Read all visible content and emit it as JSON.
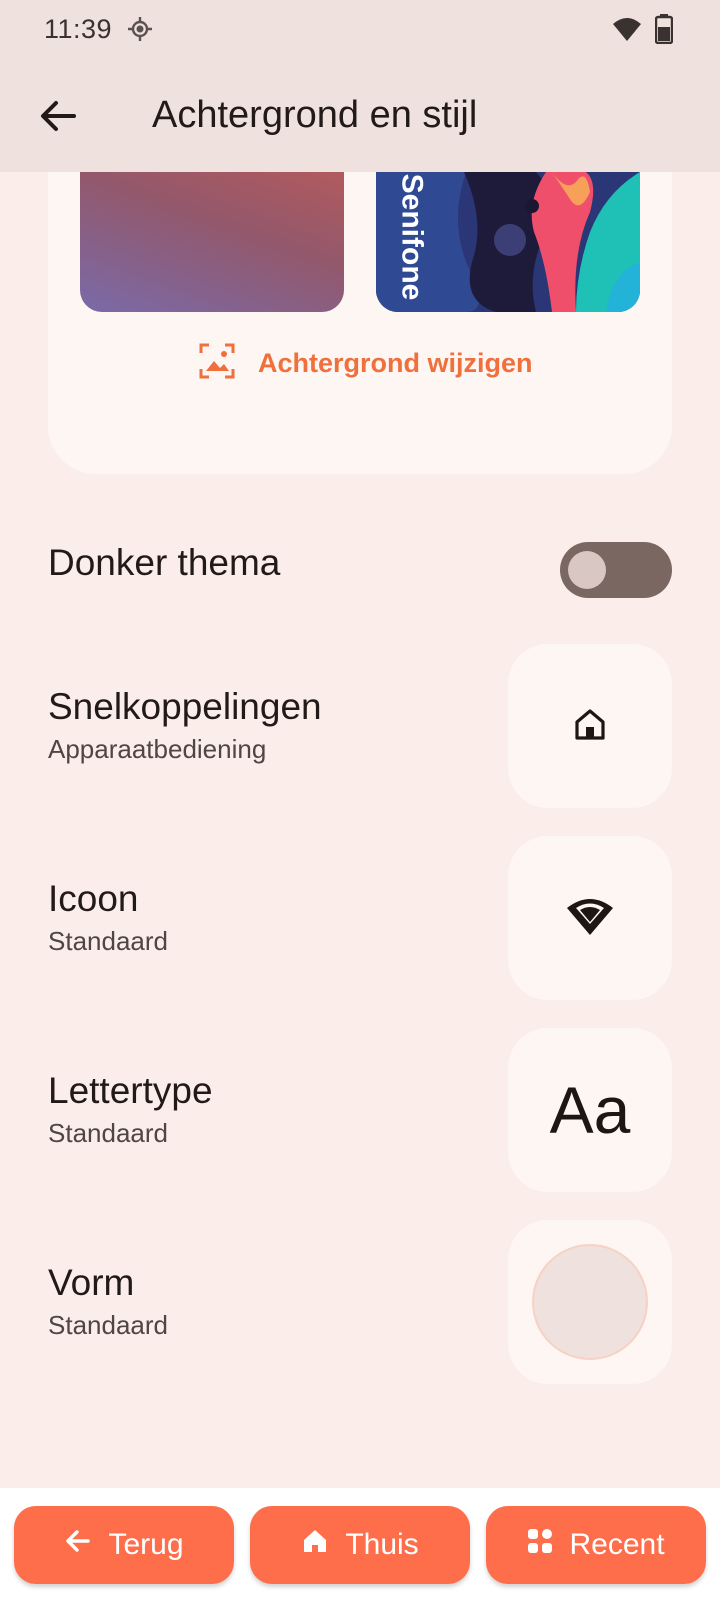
{
  "status_bar": {
    "time": "11:39"
  },
  "app_bar": {
    "title": "Achtergrond en stijl"
  },
  "wallpaper": {
    "home_brand_text": "Senifone",
    "change_label": "Achtergrond wijzigen",
    "accent_color": "#f0703d"
  },
  "dark_theme": {
    "label": "Donker thema",
    "enabled": false
  },
  "settings": [
    {
      "title": "Snelkoppelingen",
      "subtitle": "Apparaatbediening",
      "preview_icon": "home-icon"
    },
    {
      "title": "Icoon",
      "subtitle": "Standaard",
      "preview_icon": "wifi-icon"
    },
    {
      "title": "Lettertype",
      "subtitle": "Standaard",
      "preview_text": "Aa"
    },
    {
      "title": "Vorm",
      "subtitle": "Standaard",
      "preview_icon": "circle-shape"
    }
  ],
  "nav": {
    "back_label": "Terug",
    "home_label": "Thuis",
    "recent_label": "Recent",
    "button_color": "#fe6e4b"
  }
}
